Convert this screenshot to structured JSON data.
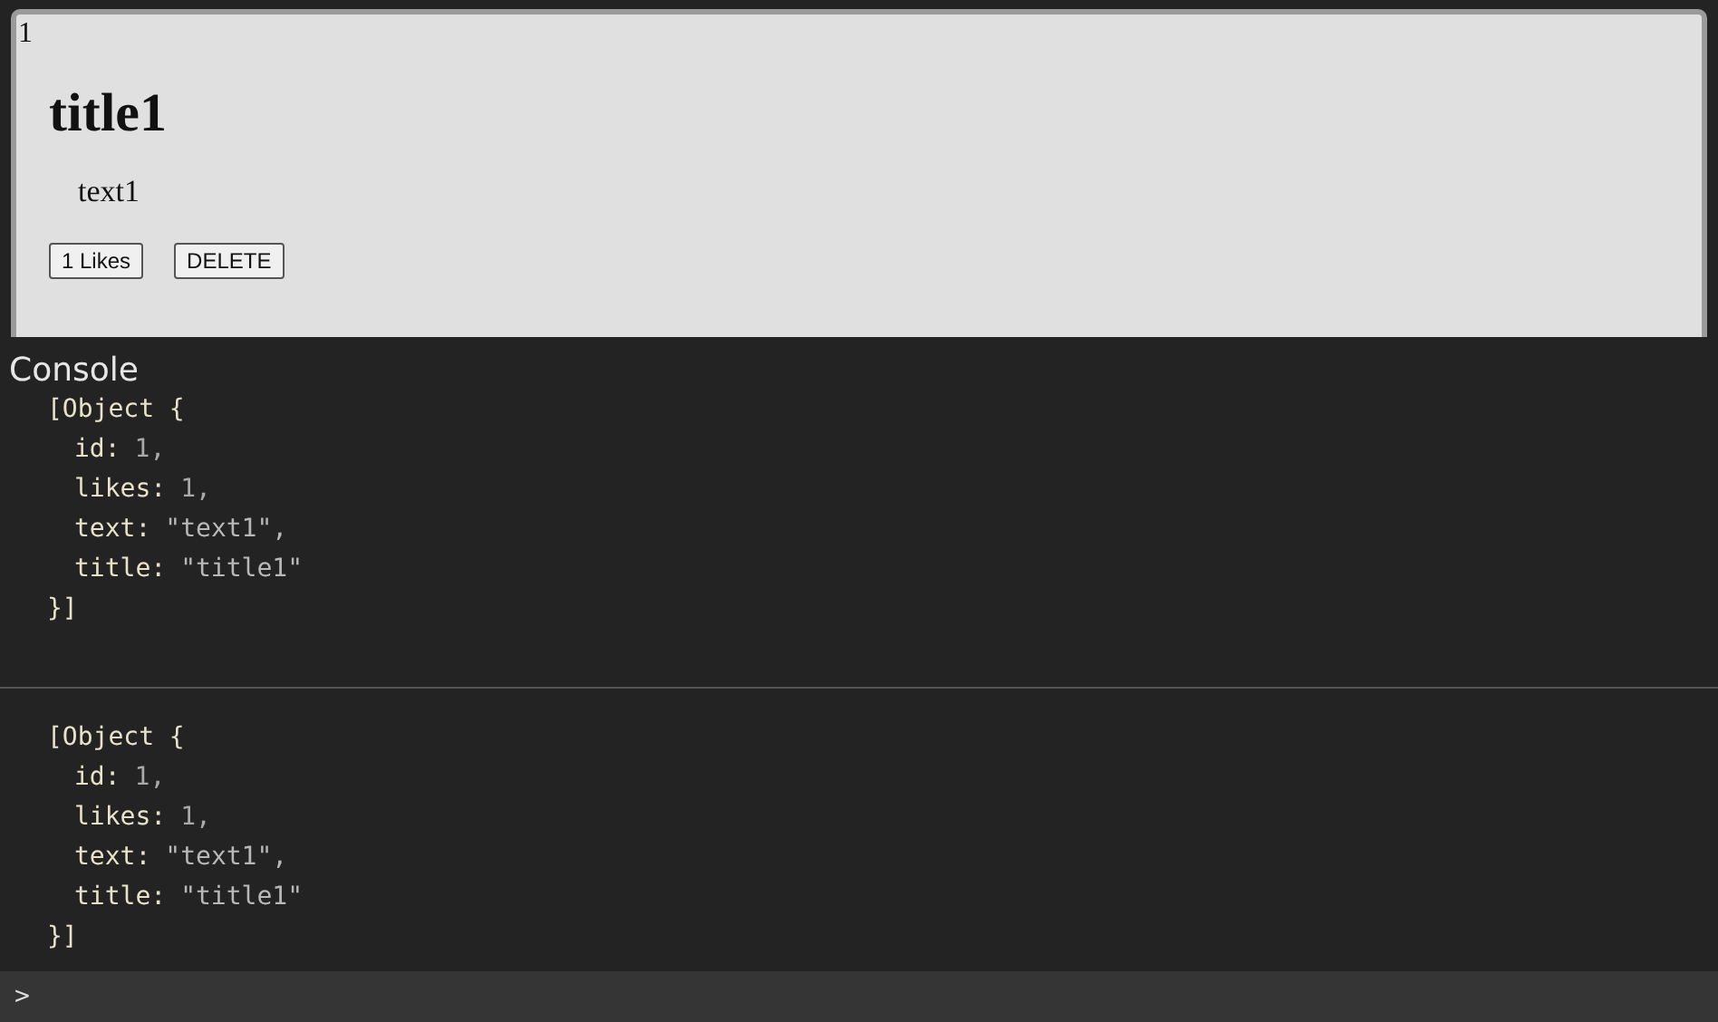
{
  "post": {
    "id": "1",
    "title": "title1",
    "text": "text1",
    "like_button": "1 Likes",
    "delete_button": "DELETE"
  },
  "console": {
    "title": "Console",
    "entries": [
      {
        "open": "[Object {",
        "fields": [
          {
            "key": "id:",
            "value": "1,",
            "kind": "number"
          },
          {
            "key": "likes:",
            "value": "1,",
            "kind": "number"
          },
          {
            "key": "text:",
            "value": "\"text1\",",
            "kind": "string"
          },
          {
            "key": "title:",
            "value": "\"title1\"",
            "kind": "string"
          }
        ],
        "close": "}]"
      },
      {
        "open": "[Object {",
        "fields": [
          {
            "key": "id:",
            "value": "1,",
            "kind": "number"
          },
          {
            "key": "likes:",
            "value": "1,",
            "kind": "number"
          },
          {
            "key": "text:",
            "value": "\"text1\",",
            "kind": "string"
          },
          {
            "key": "title:",
            "value": "\"title1\"",
            "kind": "string"
          }
        ],
        "close": "}]"
      }
    ],
    "prompt": ">"
  }
}
